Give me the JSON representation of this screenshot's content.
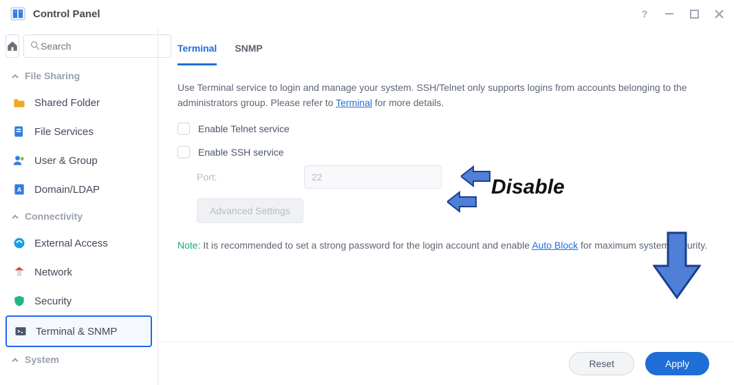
{
  "window": {
    "title": "Control Panel"
  },
  "search": {
    "placeholder": "Search"
  },
  "sections": {
    "file_sharing": "File Sharing",
    "connectivity": "Connectivity",
    "system": "System"
  },
  "nav": {
    "shared_folder": "Shared Folder",
    "file_services": "File Services",
    "user_group": "User & Group",
    "domain_ldap": "Domain/LDAP",
    "external_access": "External Access",
    "network": "Network",
    "security": "Security",
    "terminal_snmp": "Terminal & SNMP"
  },
  "tabs": {
    "terminal": "Terminal",
    "snmp": "SNMP"
  },
  "desc": {
    "part1": "Use Terminal service to login and manage your system. SSH/Telnet only supports logins from accounts belonging to the administrators group. Please refer to ",
    "link": "Terminal",
    "part2": " for more details."
  },
  "options": {
    "telnet": "Enable Telnet service",
    "ssh": "Enable SSH service",
    "port_label": "Port:",
    "port_value": "22",
    "advanced": "Advanced Settings"
  },
  "note": {
    "label": "Note:",
    "part1": " It is recommended to set a strong password for the login account and enable ",
    "link": "Auto Block",
    "part2": " for maximum system security."
  },
  "buttons": {
    "reset": "Reset",
    "apply": "Apply"
  },
  "annotation": {
    "disable": "Disable"
  }
}
